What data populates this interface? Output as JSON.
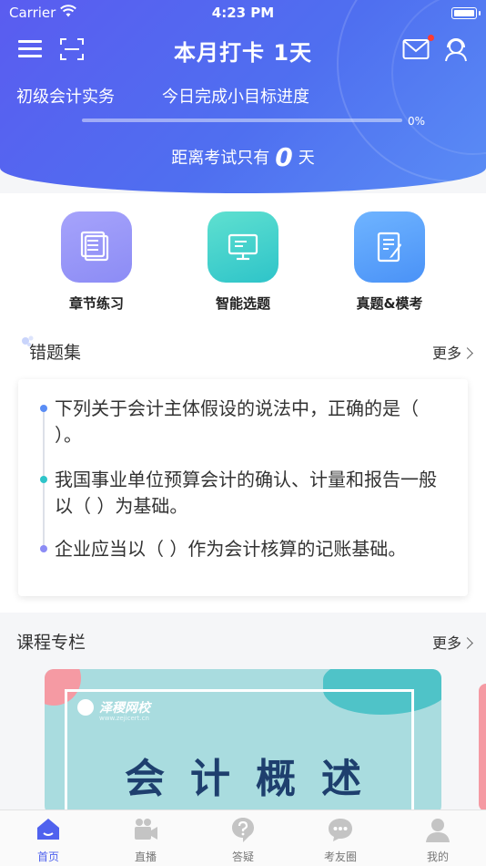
{
  "status_bar": {
    "carrier": "Carrier",
    "time": "4:23 PM"
  },
  "header": {
    "title": "本月打卡 1天",
    "subject": "初级会计实务",
    "progress_label": "今日完成小目标进度",
    "progress_percent_text": "0%",
    "progress_value": 0,
    "countdown_prefix": "距离考试只有",
    "countdown_days": "0",
    "countdown_suffix": "天",
    "icons": [
      "menu-icon",
      "scan-icon",
      "mail-icon",
      "customer-service-icon"
    ],
    "accent": "#5a5cf0"
  },
  "quick_actions": [
    {
      "label": "章节练习",
      "icon": "notebook-icon",
      "color": "#9a98f8"
    },
    {
      "label": "智能选题",
      "icon": "monitor-icon",
      "color": "#3ccfcd"
    },
    {
      "label": "真题&模考",
      "icon": "exam-paper-icon",
      "color": "#5aa2fa"
    }
  ],
  "wrong_questions": {
    "title": "错题集",
    "more": "更多",
    "items": [
      {
        "text": "下列关于会计主体假设的说法中，正确的是（ ）。",
        "dot_color": "#5a8df5"
      },
      {
        "text": "我国事业单位预算会计的确认、计量和报告一般以（ ）为基础。",
        "dot_color": "#2ec4c9"
      },
      {
        "text": "企业应当以（ ）作为会计核算的记账基础。",
        "dot_color": "#8c8cf5"
      }
    ]
  },
  "courses": {
    "title": "课程专栏",
    "more": "更多",
    "card": {
      "brand": "泽稷网校",
      "brand_url": "www.zejicert.cn",
      "name": "会计概述"
    }
  },
  "tabbar": {
    "items": [
      {
        "label": "首页",
        "icon": "home-icon",
        "active": true
      },
      {
        "label": "直播",
        "icon": "video-camera-icon",
        "active": false
      },
      {
        "label": "答疑",
        "icon": "question-icon",
        "active": false
      },
      {
        "label": "考友圈",
        "icon": "chat-bubble-icon",
        "active": false
      },
      {
        "label": "我的",
        "icon": "user-icon",
        "active": false
      }
    ],
    "active_color": "#4f62ee",
    "inactive_color": "#c4c4c4"
  }
}
